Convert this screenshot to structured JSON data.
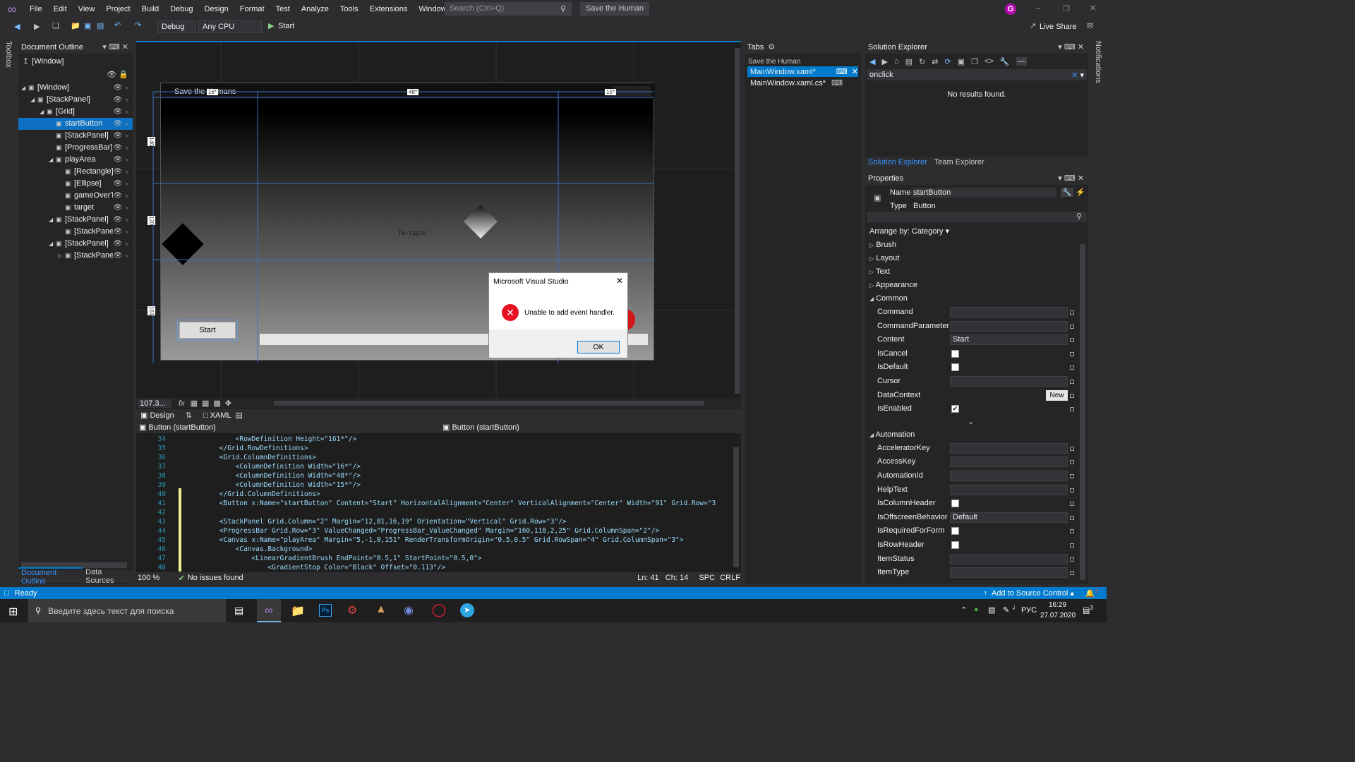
{
  "menu": {
    "items": [
      "File",
      "Edit",
      "View",
      "Project",
      "Build",
      "Debug",
      "Design",
      "Format",
      "Test",
      "Analyze",
      "Tools",
      "Extensions",
      "Window",
      "Help"
    ],
    "search_placeholder": "Search (Ctrl+Q)",
    "solution_name": "Save the Human",
    "avatar": "G"
  },
  "toolbar": {
    "config": "Debug",
    "platform": "Any CPU",
    "start": "Start",
    "live_share": "Live Share"
  },
  "left_strip": {
    "toolbox": "Toolbox"
  },
  "right_strip": {
    "notifications": "Notifications"
  },
  "outline": {
    "title": "Document Outline",
    "window_label": "[Window]",
    "items": [
      {
        "label": "[Window]",
        "depth": 0,
        "arrow": "◢"
      },
      {
        "label": "[StackPanel]",
        "depth": 1,
        "arrow": "◢"
      },
      {
        "label": "[Grid]",
        "depth": 2,
        "arrow": "◢"
      },
      {
        "label": "startButton",
        "depth": 3,
        "arrow": "",
        "selected": true
      },
      {
        "label": "[StackPanel]",
        "depth": 3,
        "arrow": ""
      },
      {
        "label": "[ProgressBar]",
        "depth": 3,
        "arrow": ""
      },
      {
        "label": "playArea",
        "depth": 3,
        "arrow": "◢"
      },
      {
        "label": "[Rectangle]",
        "depth": 4,
        "arrow": ""
      },
      {
        "label": "[Ellipse]",
        "depth": 4,
        "arrow": ""
      },
      {
        "label": "gameOverT",
        "depth": 4,
        "arrow": ""
      },
      {
        "label": "target",
        "depth": 4,
        "arrow": ""
      },
      {
        "label": "[StackPanel]",
        "depth": 3,
        "arrow": "◢"
      },
      {
        "label": "[StackPanel]",
        "depth": 4,
        "arrow": ""
      },
      {
        "label": "[StackPanel]",
        "depth": 3,
        "arrow": "◢"
      },
      {
        "label": "[StackPanel]",
        "depth": 4,
        "arrow": "▷"
      }
    ],
    "tabs": [
      "Document Outline",
      "Data Sources"
    ]
  },
  "designer": {
    "window_title": "Save the Humans",
    "col_labels": [
      "16*",
      "48*",
      "15*"
    ],
    "row_labels": [
      "140",
      "120",
      "161"
    ],
    "game_over": "Ты сдох",
    "button_label": "Start",
    "zoom": "107.3...",
    "tab_design": "Design",
    "tab_xaml": "XAML"
  },
  "dialog": {
    "title": "Microsoft Visual Studio",
    "message": "Unable to add event handler.",
    "ok": "OK"
  },
  "nav": {
    "left": "Button (startButton)",
    "right": "Button (startButton)"
  },
  "code": {
    "lines": [
      {
        "n": "34",
        "t": "            <RowDefinition Height=\"161*\"/>"
      },
      {
        "n": "35",
        "t": "        </Grid.RowDefinitions>"
      },
      {
        "n": "36",
        "t": "        <Grid.ColumnDefinitions>"
      },
      {
        "n": "37",
        "t": "            <ColumnDefinition Width=\"16*\"/>"
      },
      {
        "n": "38",
        "t": "            <ColumnDefinition Width=\"48*\"/>"
      },
      {
        "n": "39",
        "t": "            <ColumnDefinition Width=\"15*\"/>"
      },
      {
        "n": "40",
        "t": "        </Grid.ColumnDefinitions>"
      },
      {
        "n": "41",
        "t": "        <Button x:Name=\"startButton\" Content=\"Start\" HorizontalAlignment=\"Center\" VerticalAlignment=\"Center\" Width=\"91\" Grid.Row=\"3"
      },
      {
        "n": "42",
        "t": ""
      },
      {
        "n": "43",
        "t": "        <StackPanel Grid.Column=\"2\" Margin=\"12,81,16,19\" Orientation=\"Vertical\" Grid.Row=\"3\"/>"
      },
      {
        "n": "44",
        "t": "        <ProgressBar Grid.Row=\"3\" ValueChanged=\"ProgressBar_ValueChanged\" Margin=\"160,118,2,25\" Grid.ColumnSpan=\"2\"/>"
      },
      {
        "n": "45",
        "t": "        <Canvas x:Name=\"playArea\" Margin=\"5,-1,0,151\" RenderTransformOrigin=\"0.5,0.5\" Grid.RowSpan=\"4\" Grid.ColumnSpan=\"3\">"
      },
      {
        "n": "46",
        "t": "            <Canvas.Background>"
      },
      {
        "n": "47",
        "t": "                <LinearGradientBrush EndPoint=\"0.5,1\" StartPoint=\"0.5,0\">"
      },
      {
        "n": "48",
        "t": "                    <GradientStop Color=\"Black\" Offset=\"0.113\"/>"
      }
    ]
  },
  "editor_status": {
    "zoom": "100 %",
    "issues": "No issues found",
    "ln": "Ln: 41",
    "ch": "Ch: 14",
    "spc": "SPC",
    "crlf": "CRLF"
  },
  "tabs_panel": {
    "title": "Tabs",
    "group": "Save the Human",
    "files": [
      "MainWindow.xaml*",
      "MainWindow.xaml.cs*"
    ]
  },
  "solution": {
    "title": "Solution Explorer",
    "search": "onclick",
    "no_results": "No results found.",
    "tabs": [
      "Solution Explorer",
      "Team Explorer"
    ]
  },
  "properties": {
    "title": "Properties",
    "name_label": "Name",
    "name_value": "startButton",
    "type_label": "Type",
    "type_value": "Button",
    "arrange": "Arrange by: Category",
    "categories": [
      "Brush",
      "Layout",
      "Text",
      "Appearance"
    ],
    "common": "Common",
    "common_rows": [
      {
        "label": "Command",
        "kind": "box",
        "value": ""
      },
      {
        "label": "CommandParameter",
        "kind": "box",
        "value": ""
      },
      {
        "label": "Content",
        "kind": "box",
        "value": "Start"
      },
      {
        "label": "IsCancel",
        "kind": "check",
        "value": ""
      },
      {
        "label": "IsDefault",
        "kind": "check",
        "value": ""
      },
      {
        "label": "Cursor",
        "kind": "combo",
        "value": ""
      },
      {
        "label": "DataContext",
        "kind": "button",
        "value": "New"
      },
      {
        "label": "IsEnabled",
        "kind": "checked",
        "value": ""
      }
    ],
    "automation": "Automation",
    "auto_rows": [
      {
        "label": "AcceleratorKey",
        "kind": "box",
        "value": ""
      },
      {
        "label": "AccessKey",
        "kind": "box",
        "value": ""
      },
      {
        "label": "AutomationId",
        "kind": "box",
        "value": ""
      },
      {
        "label": "HelpText",
        "kind": "box",
        "value": ""
      },
      {
        "label": "IsColumnHeader",
        "kind": "check",
        "value": ""
      },
      {
        "label": "IsOffscreenBehavior",
        "kind": "combo",
        "value": "Default"
      },
      {
        "label": "IsRequiredForForm",
        "kind": "check",
        "value": ""
      },
      {
        "label": "IsRowHeader",
        "kind": "check",
        "value": ""
      },
      {
        "label": "ItemStatus",
        "kind": "box",
        "value": ""
      },
      {
        "label": "ItemType",
        "kind": "box",
        "value": ""
      }
    ]
  },
  "status": {
    "ready": "Ready",
    "source_control": "Add to Source Control",
    "badge": "3"
  },
  "taskbar": {
    "search": "Введите здесь текст для поиска",
    "lang": "РУС",
    "time": "16:29",
    "date": "27.07.2020",
    "notif": "3"
  },
  "colors": {
    "accent": "#007acc",
    "selection": "#0e70c0",
    "dialog_error": "#e81123"
  }
}
